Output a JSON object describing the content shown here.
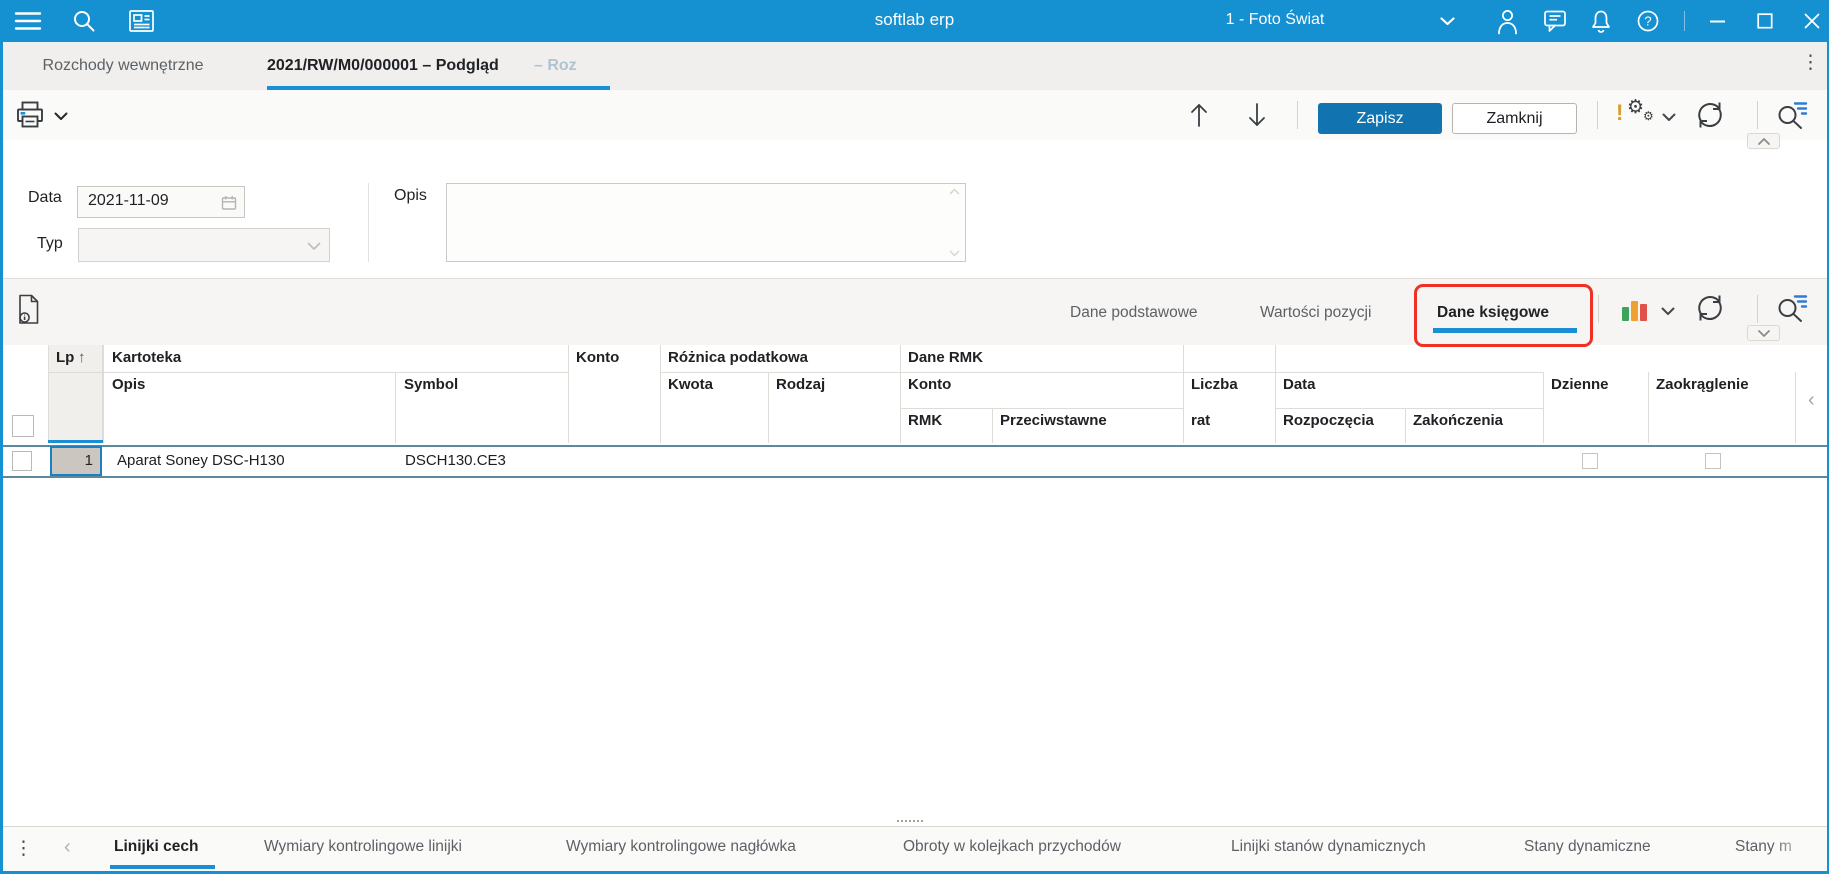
{
  "colors": {
    "topbar_bg": "#1590D0",
    "accent_blue": "#1A8FD6",
    "save_button_bg": "#1173B0",
    "highlight_red": "#EE3124",
    "row_border_blue_gray": "#5C88A0",
    "chart_icon_green": "#3FA45B",
    "chart_icon_orange": "#F0A030",
    "chart_icon_red": "#E2504A",
    "warning_icon_orange": "#D89C2A"
  },
  "topbar": {
    "title": "softlab erp",
    "company": "1 - Foto Świat"
  },
  "doc_tabs": {
    "inactive": "Rozchody wewnętrzne",
    "active": "2021/RW/M0/000001 – Podgląd",
    "active_truncated": " – Roz"
  },
  "toolbar": {
    "save_label": "Zapisz",
    "close_label": "Zamknij"
  },
  "form": {
    "data_label": "Data",
    "data_value": "2021-11-09",
    "typ_label": "Typ",
    "typ_value": "",
    "opis_label": "Opis",
    "opis_value": ""
  },
  "section_tabs": {
    "basic": "Dane podstawowe",
    "values": "Wartości pozycji",
    "accounting": "Dane księgowe"
  },
  "table": {
    "headers": {
      "lp": "Lp",
      "kartoteka": "Kartoteka",
      "konto": "Konto",
      "roznica_podatkowa": "Różnica podatkowa",
      "dane_rmk": "Dane RMK",
      "opis": "Opis",
      "symbol": "Symbol",
      "kwota": "Kwota",
      "rodzaj": "Rodzaj",
      "konto_rmk": "Konto",
      "liczba": "Liczba",
      "rat": "rat",
      "data": "Data",
      "rozpoczecia": "Rozpoczęcia",
      "zakonczenia": "Zakończenia",
      "dzienne": "Dzienne",
      "zaokraglenie": "Zaokrąglenie",
      "rmk": "RMK",
      "przeciwstawne": "Przeciwstawne"
    },
    "rows": [
      {
        "lp": "1",
        "opis": "Aparat Soney DSC-H130",
        "symbol": "DSCH130.CE3"
      }
    ]
  },
  "bottom_tabs": {
    "items": [
      "Linijki cech",
      "Wymiary kontrolingowe linijki",
      "Wymiary kontrolingowe nagłówka",
      "Obroty w kolejkach przychodów",
      "Linijki stanów dynamicznych",
      "Stany dynamiczne",
      "Stany m"
    ]
  }
}
